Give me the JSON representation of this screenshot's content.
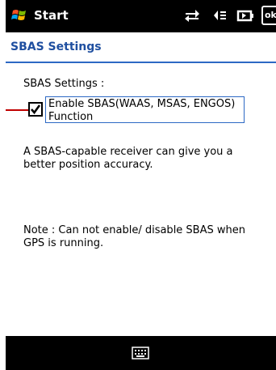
{
  "status_bar": {
    "start_label": "Start",
    "ok_label": "ok",
    "icons": [
      "windows-flag-icon",
      "connectivity-icon",
      "volume-icon",
      "battery-icon"
    ]
  },
  "title": "SBAS Settings",
  "content": {
    "section_label": "SBAS Settings :",
    "checkbox": {
      "label_line1": "Enable SBAS(WAAS, MSAS, ENGOS)",
      "label_line2": "Function",
      "checked": true
    },
    "description": "A SBAS-capable receiver can give you a better position accuracy.",
    "note": "Note : Can not enable/ disable SBAS when GPS is running."
  },
  "menu_bar": {
    "icons": [
      "keyboard-icon"
    ]
  },
  "colors": {
    "bar_bg": "#000000",
    "title_text": "#1f4fa0",
    "accent_border": "#2d69c4",
    "annotation": "#c00000"
  }
}
